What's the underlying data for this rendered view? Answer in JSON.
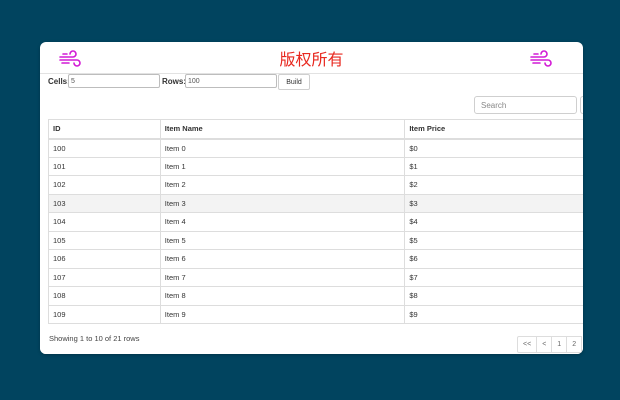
{
  "colors": {
    "page_bg": "#01445f",
    "banner_text": "#e8281f",
    "icon": "#d21bd5"
  },
  "banner": {
    "title": "版权所有",
    "left_icon": "wind-icon",
    "right_icon": "wind-icon"
  },
  "controls": {
    "cells_label": "Cells:",
    "cells_value": "5",
    "rows_label": "Rows:",
    "rows_value": "100",
    "build_label": "Build"
  },
  "search": {
    "placeholder": "Search"
  },
  "table": {
    "headers": [
      "ID",
      "Item Name",
      "Item Price"
    ],
    "rows": [
      [
        "100",
        "Item 0",
        "$0"
      ],
      [
        "101",
        "Item 1",
        "$1"
      ],
      [
        "102",
        "Item 2",
        "$2"
      ],
      [
        "103",
        "Item 3",
        "$3"
      ],
      [
        "104",
        "Item 4",
        "$4"
      ],
      [
        "105",
        "Item 5",
        "$5"
      ],
      [
        "106",
        "Item 6",
        "$6"
      ],
      [
        "107",
        "Item 7",
        "$7"
      ],
      [
        "108",
        "Item 8",
        "$8"
      ],
      [
        "109",
        "Item 9",
        "$9"
      ]
    ]
  },
  "footer": {
    "showing": "Showing 1 to 10 of 21 rows",
    "pages": [
      "<<",
      "<",
      "1",
      "2"
    ]
  }
}
